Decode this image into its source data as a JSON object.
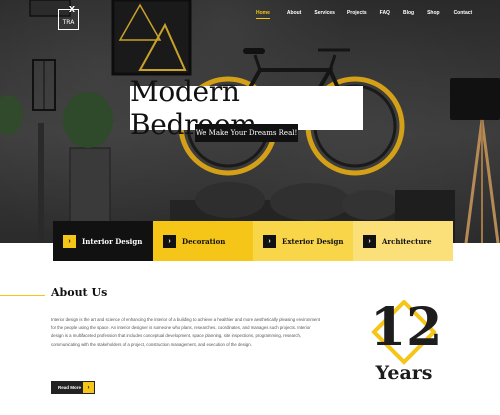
{
  "header": {
    "logo_text": "TRA",
    "logo_mark": "X",
    "nav": [
      {
        "label": "Home",
        "active": true
      },
      {
        "label": "About",
        "active": false
      },
      {
        "label": "Services",
        "active": false
      },
      {
        "label": "Projects",
        "active": false
      },
      {
        "label": "FAQ",
        "active": false
      },
      {
        "label": "Blog",
        "active": false
      },
      {
        "label": "Shop",
        "active": false
      },
      {
        "label": "Contact",
        "active": false
      }
    ]
  },
  "hero": {
    "title": "Modern Bedroom",
    "subtitle": "We Make Your Dreams Real!"
  },
  "categories": [
    {
      "label": "Interior Design",
      "bg": "#111111",
      "fg": "#ffffff",
      "arrow_bg": "#f5c518",
      "arrow_fg": "#111111"
    },
    {
      "label": "Decoration",
      "bg": "#f5c518",
      "fg": "#111111",
      "arrow_bg": "#111111",
      "arrow_fg": "#ffffff"
    },
    {
      "label": "Exterior Design",
      "bg": "#f9d54a",
      "fg": "#111111",
      "arrow_bg": "#111111",
      "arrow_fg": "#ffffff"
    },
    {
      "label": "Architecture",
      "bg": "#fbe07a",
      "fg": "#111111",
      "arrow_bg": "#111111",
      "arrow_fg": "#ffffff"
    }
  ],
  "about": {
    "title": "About Us",
    "text": "Interior design is the art and science of enhancing the interior of a building to achieve a healthier and more aesthetically pleasing environment for the people using the space. An interior designer is someone who plans, researches, coordinates, and manages such projects. Interior design is a multifaceted profession that includes conceptual development, space planning, site inspections, programming, research, communicating with the stakeholders of a project, construction management, and execution of the design.",
    "button_label": "Read More",
    "button_icon": "chevron-right-icon"
  },
  "badge": {
    "number": "12",
    "label": "Years"
  },
  "colors": {
    "accent": "#f5c518",
    "dark": "#111111"
  }
}
